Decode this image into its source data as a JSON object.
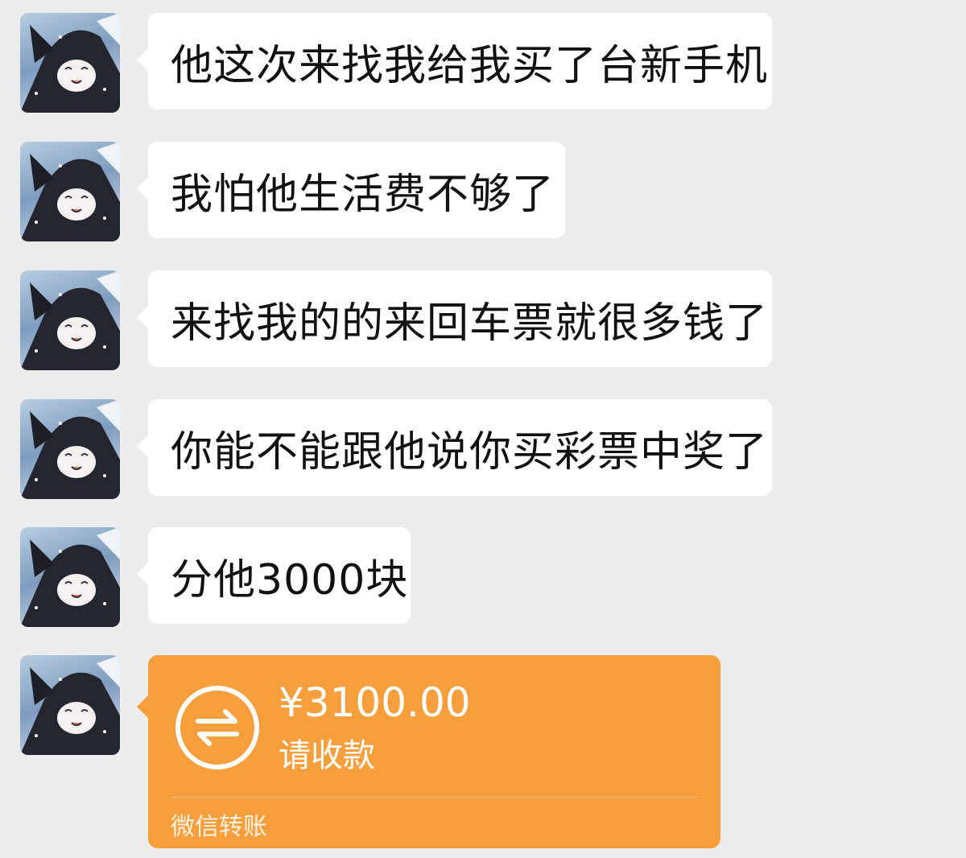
{
  "messages": [
    {
      "text": "他这次来找我给我买了台新手机"
    },
    {
      "text": "我怕他生活费不够了"
    },
    {
      "text": "来找我的的来回车票就很多钱了"
    },
    {
      "text": "你能不能跟他说你买彩票中奖了"
    },
    {
      "text": "分他3000块"
    }
  ],
  "transfer": {
    "amount": "¥3100.00",
    "status": "请收款",
    "footer": "微信转账",
    "icon": "transfer-arrows-icon"
  },
  "colors": {
    "background": "#ededed",
    "bubble": "#ffffff",
    "transfer_card": "#f79f3d"
  }
}
